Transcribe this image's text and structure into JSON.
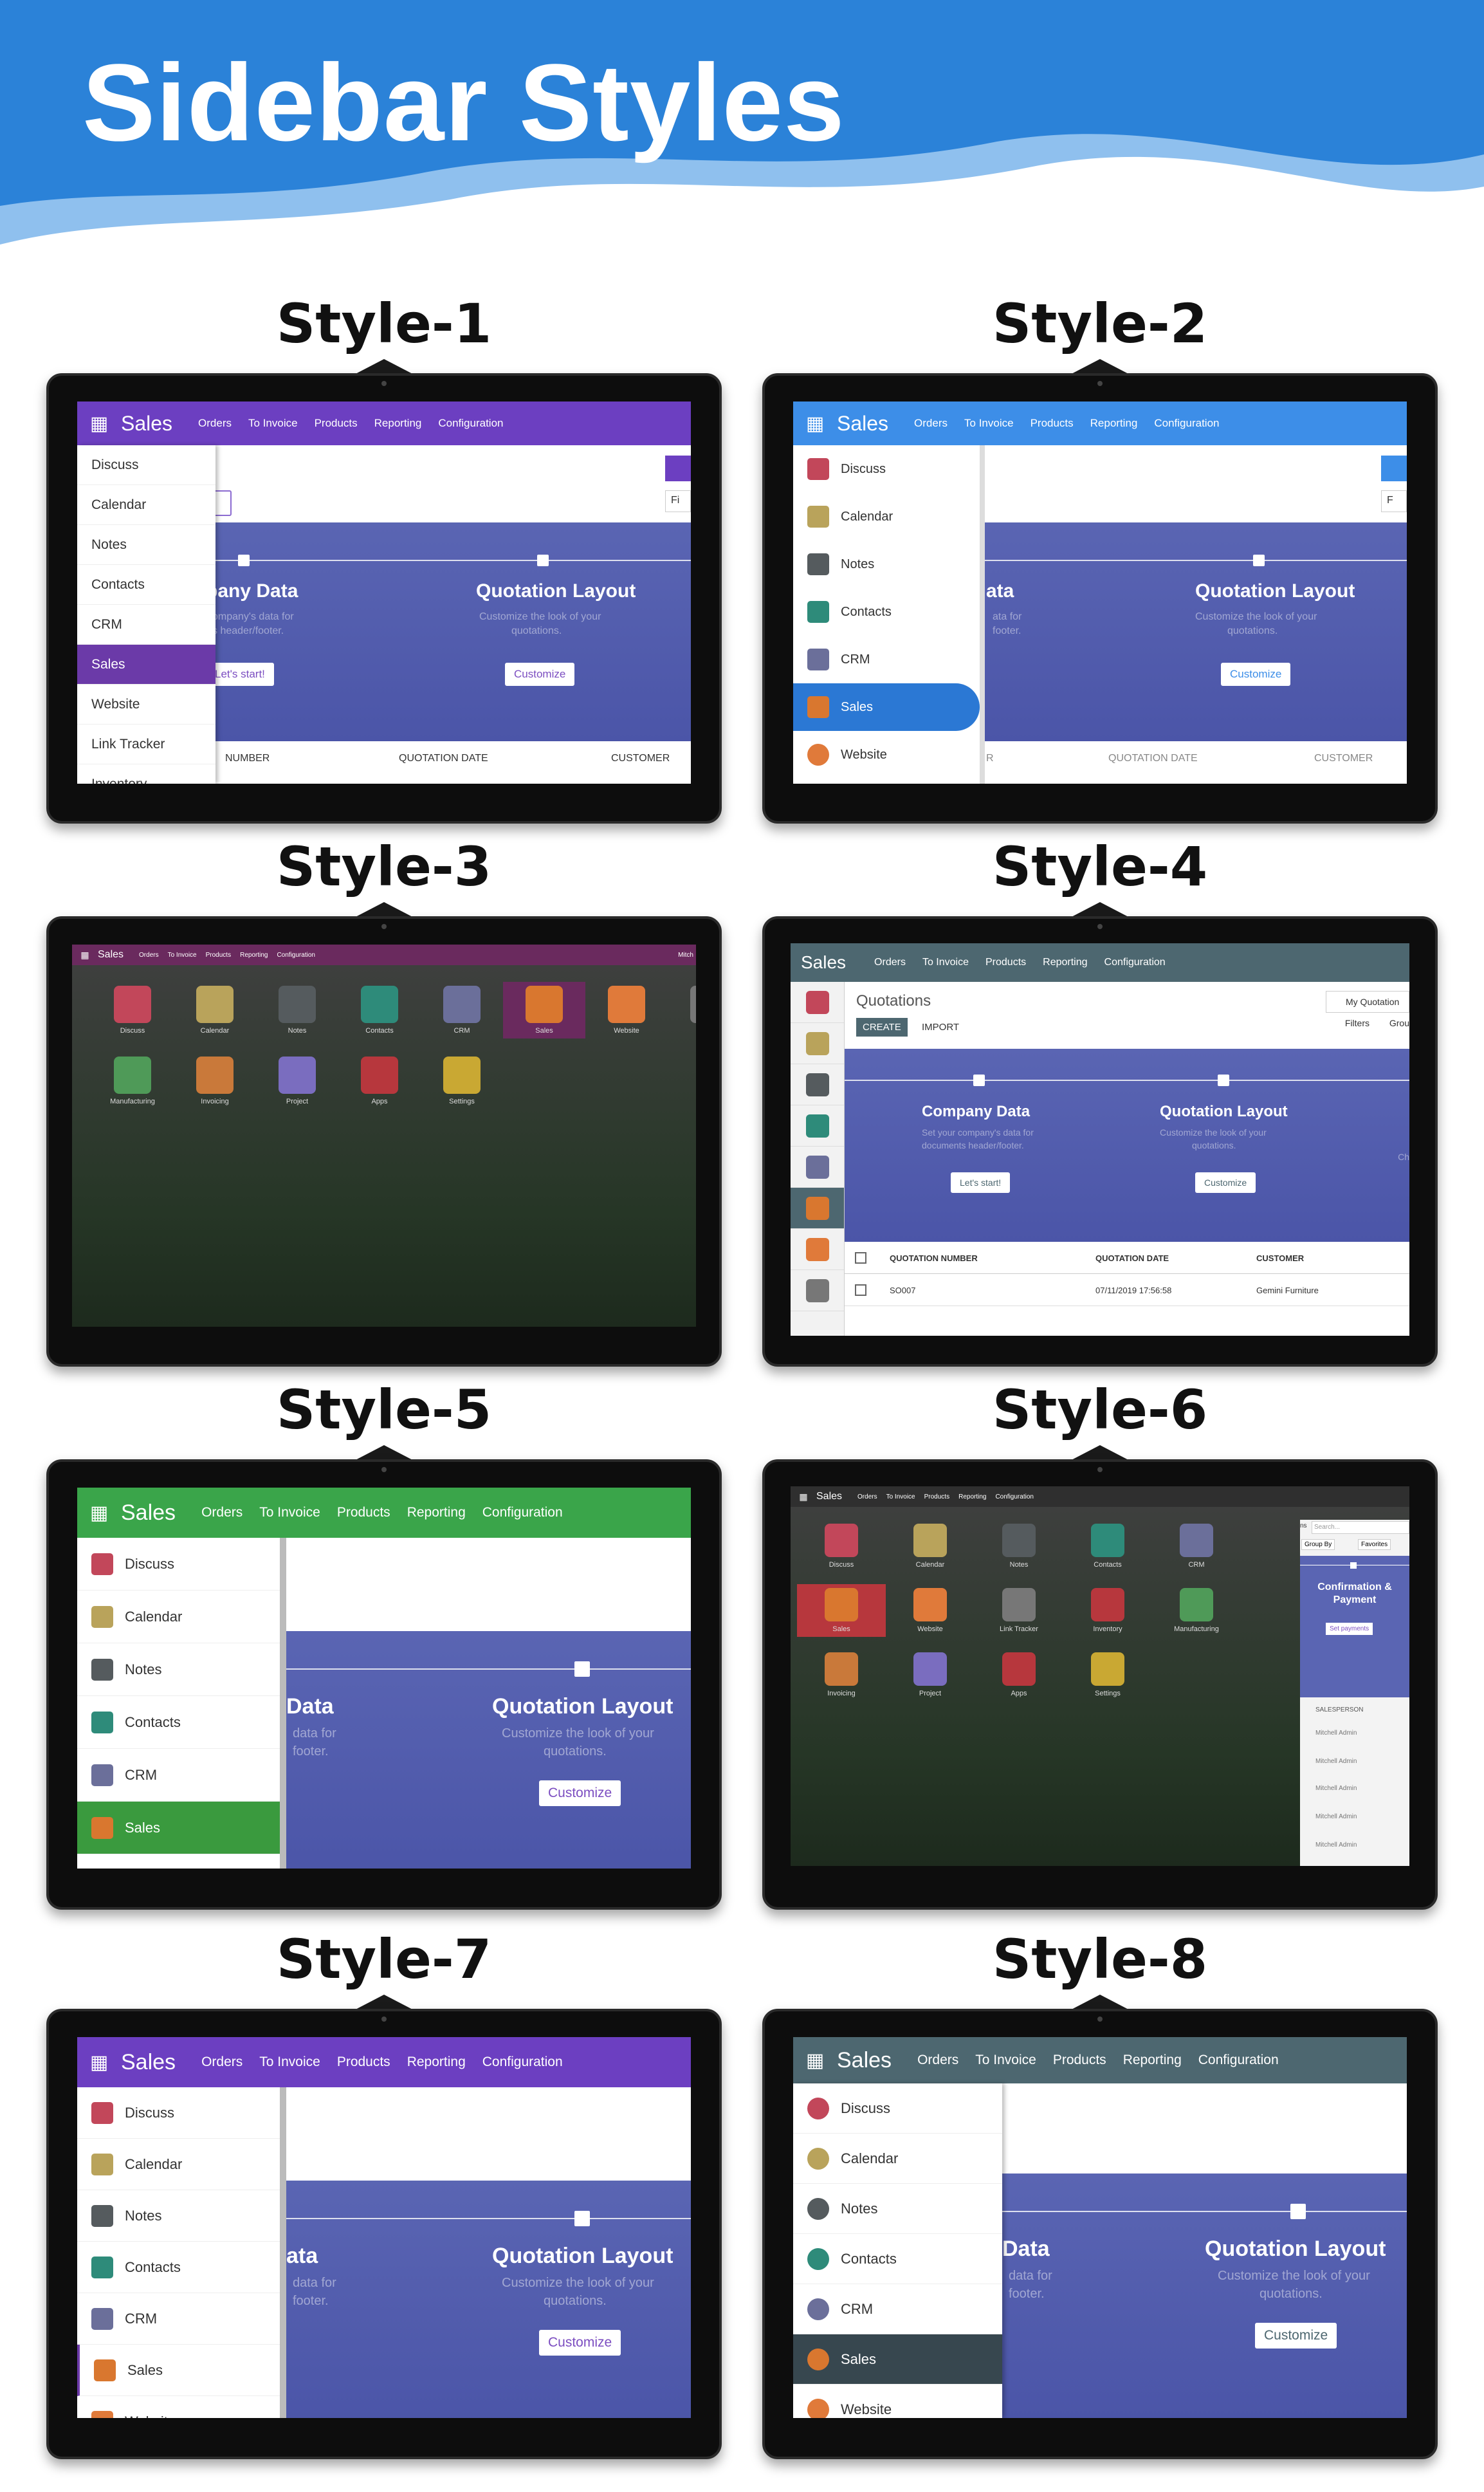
{
  "banner": {
    "title": "Sidebar Styles"
  },
  "app": {
    "apps_glyph": "▦",
    "name": "Sales",
    "menu": [
      "Orders",
      "To Invoice",
      "Products",
      "Reporting",
      "Configuration"
    ]
  },
  "styles": [
    "Style-1",
    "Style-2",
    "Style-3",
    "Style-4",
    "Style-5",
    "Style-6",
    "Style-7",
    "Style-8"
  ],
  "s1": {
    "sidebar": [
      "Discuss",
      "Calendar",
      "Notes",
      "Contacts",
      "CRM",
      "Sales",
      "Website",
      "Link Tracker",
      "Inventory"
    ],
    "banner_left": "pany Data",
    "banner_left_sub": "ompany's data for",
    "banner_left_sub2": "s header/footer.",
    "banner_left_btn": "Let's start!",
    "banner_right": "Quotation Layout",
    "banner_right_sub": "Customize the look of your",
    "banner_right_sub2": "quotations.",
    "banner_right_btn": "Customize",
    "cols": [
      "NUMBER",
      "QUOTATION DATE",
      "CUSTOMER"
    ],
    "filter": "Fi"
  },
  "s2": {
    "sidebar": [
      "Discuss",
      "Calendar",
      "Notes",
      "Contacts",
      "CRM",
      "Sales",
      "Website"
    ],
    "banner_left": "ata",
    "banner_left_sub": "ata for",
    "banner_left_sub2": "footer.",
    "banner_right": "Quotation Layout",
    "banner_right_sub": "Customize the look of your",
    "banner_right_sub2": "quotations.",
    "banner_right_btn": "Customize",
    "cols": [
      "R",
      "QUOTATION DATE",
      "CUSTOMER"
    ],
    "filter": "F"
  },
  "s3": {
    "apps": [
      "Discuss",
      "Calendar",
      "Notes",
      "Contacts",
      "CRM",
      "Sales",
      "Website",
      "Link Tr",
      "Manufacturing",
      "Invoicing",
      "Project",
      "Apps",
      "Settings"
    ],
    "user": "Mitch"
  },
  "s4": {
    "title": "Quotations",
    "create": "CREATE",
    "import": "IMPORT",
    "myq": "My Quotation",
    "filters": "Filters",
    "group": "Grou",
    "left": "Company Data",
    "left_sub": "Set your company's data for",
    "left_sub2": "documents header/footer.",
    "left_btn": "Let's start!",
    "right": "Quotation Layout",
    "right_sub": "Customize the look of your",
    "right_sub2": "quotations.",
    "right_btn": "Customize",
    "edge": "Ch",
    "cols": [
      "QUOTATION NUMBER",
      "QUOTATION DATE",
      "CUSTOMER"
    ],
    "row": [
      "SO007",
      "07/11/2019 17:56:58",
      "Gemini Furniture"
    ]
  },
  "s5": {
    "sidebar": [
      "Discuss",
      "Calendar",
      "Notes",
      "Contacts",
      "CRM",
      "Sales"
    ],
    "banner_left": "Data",
    "banner_left_sub": "data for",
    "banner_left_sub2": "footer.",
    "banner_right": "Quotation Layout",
    "banner_right_sub": "Customize the look of your",
    "banner_right_sub2": "quotations.",
    "banner_right_btn": "Customize"
  },
  "s6": {
    "apps": [
      "Discuss",
      "Calendar",
      "Notes",
      "Contacts",
      "CRM",
      "Sales",
      "Website",
      "Link Tracker",
      "Inventory",
      "Manufacturing",
      "Invoicing",
      "Project",
      "Apps",
      "Settings"
    ],
    "search": "Search...",
    "groupby": "Group By",
    "favorites": "Favorites",
    "conf": "Confirmation &",
    "conf2": "Payment",
    "setpay": "Set payments",
    "sales": "SALESPERSON",
    "person": "Mitchell Admin",
    "ns": "ns"
  },
  "s7": {
    "sidebar": [
      "Discuss",
      "Calendar",
      "Notes",
      "Contacts",
      "CRM",
      "Sales",
      "Website"
    ],
    "banner_left": "ata",
    "banner_left_sub": "data for",
    "banner_left_sub2": "footer.",
    "banner_right": "Quotation Layout",
    "banner_right_sub": "Customize the look of your",
    "banner_right_sub2": "quotations.",
    "banner_right_btn": "Customize"
  },
  "s8": {
    "sidebar": [
      "Discuss",
      "Calendar",
      "Notes",
      "Contacts",
      "CRM",
      "Sales",
      "Website"
    ],
    "banner_left": "Data",
    "banner_left_sub": "data for",
    "banner_left_sub2": "footer.",
    "banner_right": "Quotation Layout",
    "banner_right_sub": "Customize the look of your",
    "banner_right_sub2": "quotations.",
    "banner_right_btn": "Customize"
  },
  "colors": {
    "purple": "#6c3fc1",
    "blue": "#3d8ee8",
    "green": "#3aa54a",
    "slate": "#4d6770",
    "plum": "#6a2a5e",
    "dark": "#2f2f2f",
    "banner_blue": "#2b82d8",
    "active_purple": "#6b3aa8",
    "active_blue": "#2b78d4",
    "active_green": "#3a9a3e",
    "active_slate": "#37474f"
  },
  "icon_colors": [
    "#c2475a",
    "#b9a35b",
    "#555b5e",
    "#2e8b7a",
    "#6b6f9a",
    "#d9772f",
    "#e07a3a",
    "#777777",
    "#4f9a58",
    "#c9793a",
    "#7a6dbf",
    "#b7373d",
    "#c9a833"
  ]
}
